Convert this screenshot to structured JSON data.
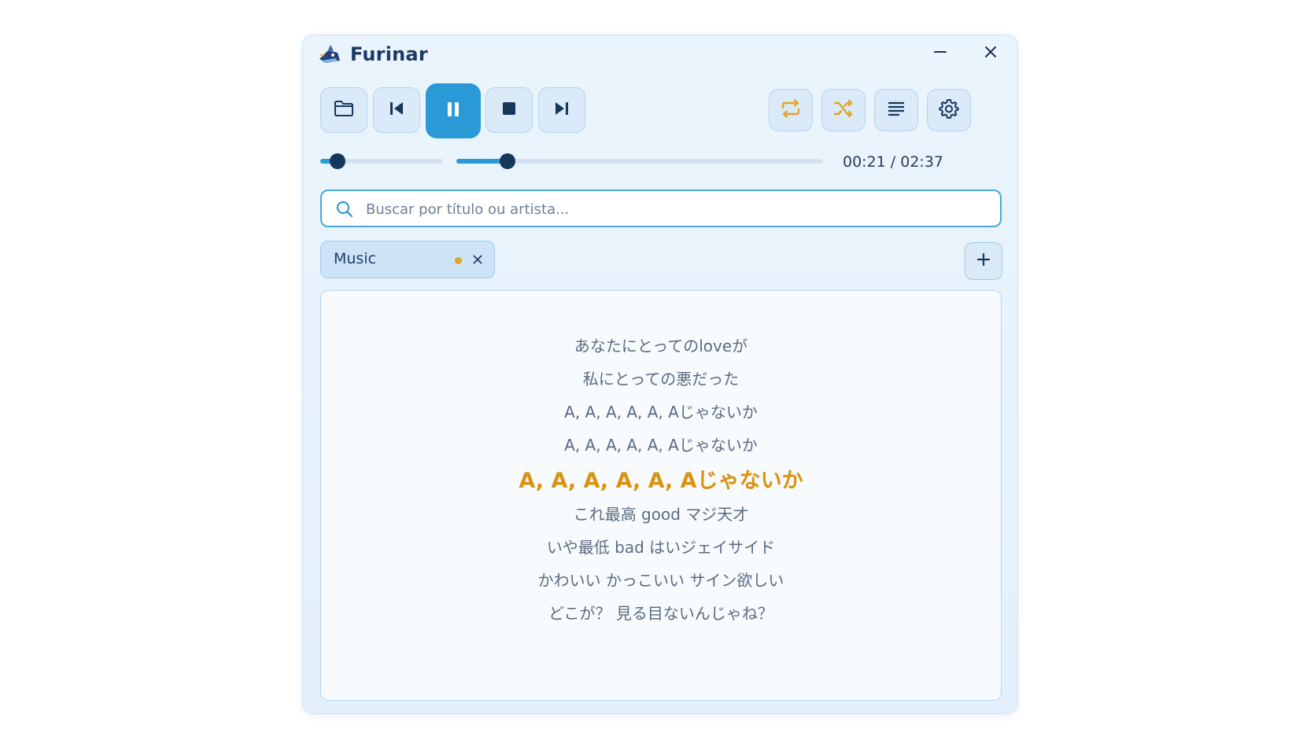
{
  "window": {
    "title": "Furinar",
    "minimize_icon": "minimize-icon",
    "close_icon": "close-icon"
  },
  "toolbar": {
    "left_buttons": [
      "open-folder-icon",
      "skip-previous-icon",
      "pause-icon",
      "stop-icon",
      "skip-next-icon"
    ],
    "right_buttons": [
      "repeat-icon",
      "shuffle-icon",
      "lyrics-list-icon",
      "settings-icon"
    ]
  },
  "volume": {
    "level": 0.14
  },
  "progress": {
    "fraction": 0.14,
    "time_display": "00:21 / 02:37"
  },
  "search": {
    "placeholder": "Buscar por título ou artista...",
    "value": ""
  },
  "tabs": [
    {
      "label": "Music",
      "modified": true
    }
  ],
  "lyrics": {
    "active_index": 4,
    "lines": [
      "あなたにとってのloveが",
      "私にとっての悪だった",
      "A, A, A, A, A, Aじゃないか",
      "A, A, A, A, A, Aじゃないか",
      "A, A, A, A, A,  Aじゃないか",
      "これ最高 good マジ天才",
      "いや最低 bad はいジェイサイド",
      "かわいい かっこいい サイン欲しい",
      "どこが？ 見る目ないんじゃね？"
    ]
  },
  "colors": {
    "accent": "#2a9ad6",
    "active_lyric": "#d9930f",
    "icon_dark": "#17365c",
    "icon_orange": "#e0a42a",
    "window_bg": "#e6f1fb"
  }
}
